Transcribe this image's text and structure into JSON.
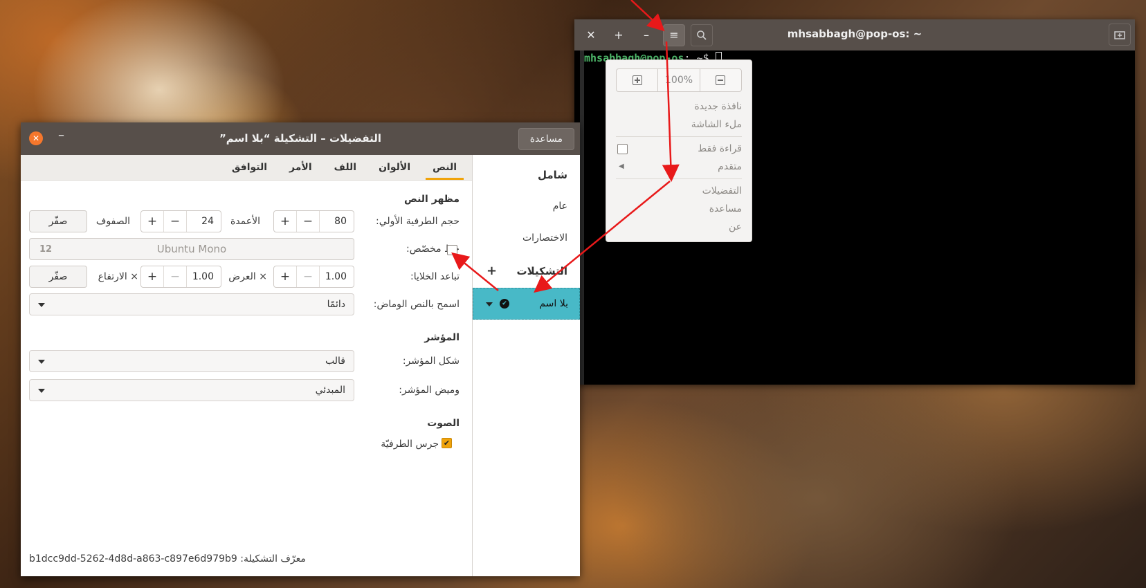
{
  "terminal": {
    "title": "mhsabbagh@pop-os: ~",
    "buttons": {
      "close": "✕",
      "new_tab": "+",
      "minimize": "–",
      "menu": "≡",
      "search": "⌕"
    },
    "prompt_user": "mhsabbagh@pop-os",
    "prompt_rest": ": ~$"
  },
  "menu": {
    "zoom_value": "100%",
    "items": {
      "new_window": "نافذة جديدة",
      "fullscreen": "ملء الشاشة",
      "read_only": "قراءة فقط",
      "advanced": "متقدم",
      "preferences": "التفضيلات",
      "help": "مساعدة",
      "about": "عن"
    }
  },
  "prefs": {
    "title": "التفضيلات – التشكيلة “بلا اسم”",
    "help_button": "مساعدة",
    "sidebar": {
      "general_header": "شامل",
      "general": "عام",
      "shortcuts": "الاختصارات",
      "profiles_header": "التشكيلات",
      "add": "+",
      "profile_name": "بلا اسم"
    },
    "tabs": [
      "النص",
      "الألوان",
      "اللف",
      "الأمر",
      "التوافق"
    ],
    "text": {
      "appearance_header": "مظهر النص",
      "initial_size_label": "حجم الطرفية الأولي:",
      "columns_value": "80",
      "columns_label": "الأعمدة",
      "rows_value": "24",
      "rows_label": "الصفوف",
      "reset": "صفّر",
      "custom_font_label": "خط مخصّص:",
      "font_name": "Ubuntu Mono",
      "font_size": "12",
      "cell_spacing_label": "تباعد الخلايا:",
      "width_value": "1.00",
      "width_label": "× العرض",
      "height_value": "1.00",
      "height_label": "× الارتفاع",
      "blink_label": "اسمح بالنص الوماض:",
      "blink_value": "دائمًا",
      "cursor_header": "المؤشر",
      "cursor_shape_label": "شكل المؤشر:",
      "cursor_shape_value": "قالب",
      "cursor_blink_label": "وميض المؤشر:",
      "cursor_blink_value": "المبدئي",
      "sound_header": "الصوت",
      "bell_label": "جرس الطرفيّة",
      "profile_id_label": "معرّف التشكيلة:",
      "profile_id_value": "b1dcc9dd-5262-4d8d-a863-c897e6d979b9"
    }
  },
  "colors": {
    "accent": "#f0a30a",
    "selection": "#48b9c7",
    "header": "#574f4a",
    "close": "#f6772c",
    "annotation": "#e8191a"
  }
}
